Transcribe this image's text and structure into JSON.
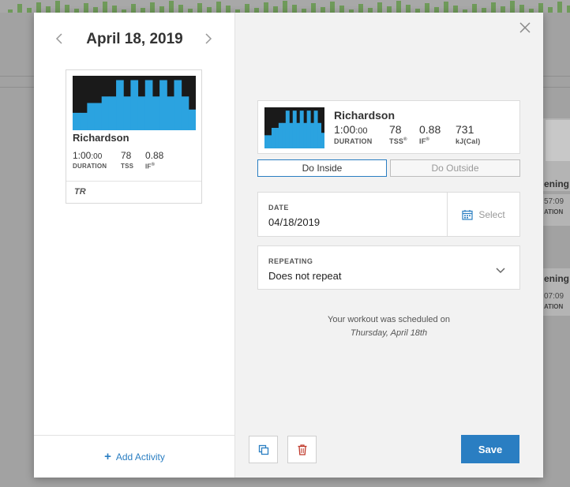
{
  "background": {
    "cards": [
      {
        "title": "ening",
        "value": "57",
        "unit": ":09",
        "label": "ATION"
      },
      {
        "title": "ening",
        "value": "07",
        "unit": ":09",
        "label": "ATION"
      }
    ]
  },
  "modal": {
    "date_title": "April 18, 2019",
    "prev_icon": "chevron-left-icon",
    "next_icon": "chevron-right-icon",
    "close_icon": "close-icon",
    "workout_card": {
      "name": "Richardson",
      "duration_value": "1:00",
      "duration_seconds": ":00",
      "duration_label": "DURATION",
      "tss_value": "78",
      "tss_label": "TSS",
      "if_value": "0.88",
      "if_label": "IF",
      "registered_mark": "®",
      "brand": "TR"
    },
    "add_activity_label": "Add Activity",
    "summary": {
      "name": "Richardson",
      "duration_value": "1:00",
      "duration_seconds": ":00",
      "duration_label": "DURATION",
      "tss_value": "78",
      "tss_label": "TSS",
      "if_value": "0.88",
      "if_label": "IF",
      "kj_value": "731",
      "kj_label": "kJ(Cal)",
      "registered_mark": "®"
    },
    "toggle": {
      "inside_label": "Do Inside",
      "outside_label": "Do Outside",
      "selected": "inside"
    },
    "date_field": {
      "label": "DATE",
      "value": "04/18/2019",
      "select_label": "Select",
      "select_icon": "calendar-icon"
    },
    "repeat_field": {
      "label": "REPEATING",
      "value": "Does not repeat",
      "dropdown_icon": "chevron-down-icon"
    },
    "scheduled_message": "Your workout was scheduled on",
    "scheduled_date": "Thursday, April 18th",
    "copy_icon": "copy-icon",
    "delete_icon": "trash-icon",
    "save_label": "Save"
  },
  "colors": {
    "accent": "#2a7ec2",
    "graph_bg": "#1a1a1a",
    "graph_fill": "#2ba3e0",
    "delete": "#c0392b"
  },
  "interval_profile": [
    0.32,
    0.32,
    0.5,
    0.5,
    0.62,
    0.62,
    0.92,
    0.62,
    0.92,
    0.62,
    0.92,
    0.62,
    0.92,
    0.62,
    0.92,
    0.62,
    0.38
  ]
}
